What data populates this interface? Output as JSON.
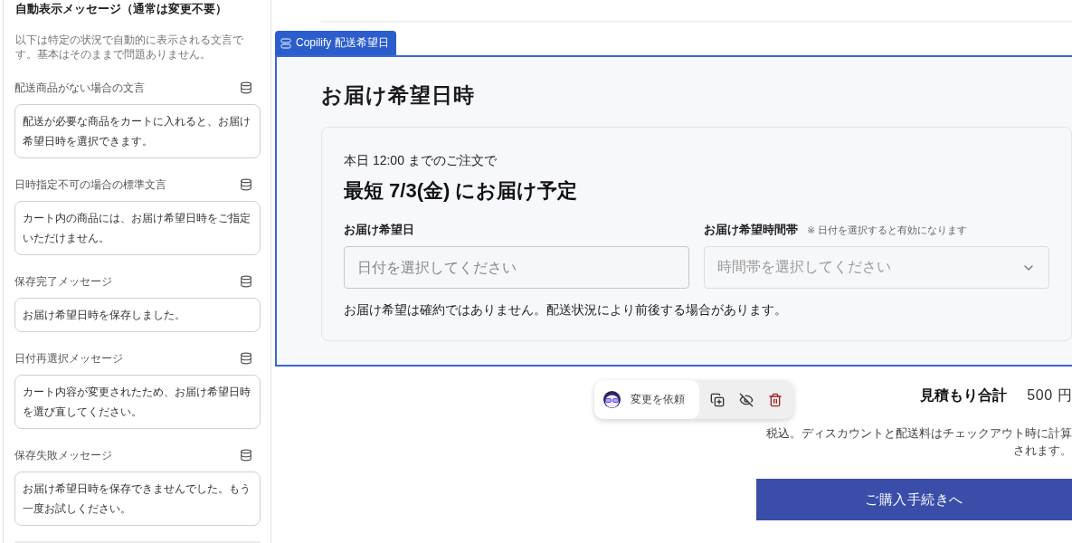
{
  "sidebar": {
    "title": "自動表示メッセージ（通常は変更不要）",
    "description": "以下は特定の状況で自動的に表示される文言です。基本はそのままで問題ありません。",
    "messages": [
      {
        "label": "配送商品がない場合の文言",
        "value": "配送が必要な商品をカートに入れると、お届け希望日時を選択できます。"
      },
      {
        "label": "日時指定不可の場合の標準文言",
        "value": "カート内の商品には、お届け希望日時をご指定いただけません。"
      },
      {
        "label": "保存完了メッセージ",
        "value": "お届け希望日時を保存しました。"
      },
      {
        "label": "日付再選択メッセージ",
        "value": "カート内容が変更されたため、お届け希望日時を選び直してください。"
      },
      {
        "label": "保存失敗メッセージ",
        "value": "お届け希望日時を保存できませんでした。もう一度お試しください。"
      }
    ]
  },
  "block_tab": {
    "label": "Copilify 配送希望日"
  },
  "delivery": {
    "heading": "お届け希望日時",
    "cutoff": "本日 12:00 までのご注文で",
    "earliest": "最短 7/3(金) にお届け予定",
    "date_field": {
      "label": "お届け希望日",
      "placeholder": "日付を選択してください",
      "disabled": false
    },
    "time_field": {
      "label": "お届け希望時間帯",
      "hint": "※ 日付を選択すると有効になります",
      "placeholder": "時間帯を選択してください",
      "disabled": true
    },
    "note": "お届け希望は確約ではありません。配送状況により前後する場合があります。"
  },
  "block_toolbar": {
    "request_label": "変更を依頼"
  },
  "summary": {
    "total_label": "見積もり合計",
    "total_value": "500 円",
    "tax_note": "税込。ディスカウントと配送料はチェックアウト時に計算されます。",
    "checkout_button": "ご購入手続きへ"
  }
}
